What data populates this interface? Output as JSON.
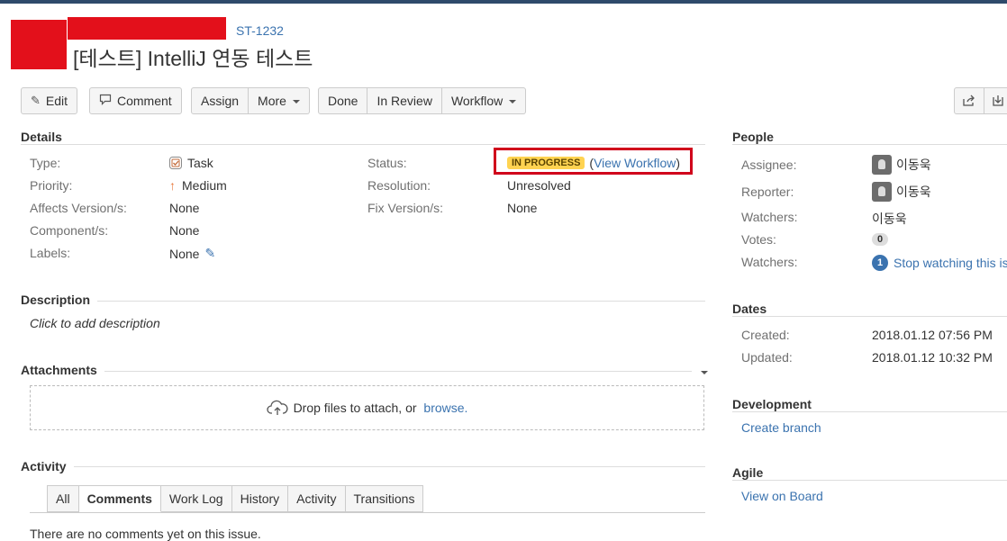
{
  "issue": {
    "key": "ST-1232",
    "title": "[테스트] IntelliJ 연동 테스트"
  },
  "toolbar": {
    "edit": "Edit",
    "comment": "Comment",
    "assign": "Assign",
    "more": "More",
    "done": "Done",
    "in_review": "In Review",
    "workflow": "Workflow"
  },
  "details": {
    "title": "Details",
    "type_label": "Type:",
    "type_value": "Task",
    "priority_label": "Priority:",
    "priority_value": "Medium",
    "affects_label": "Affects Version/s:",
    "affects_value": "None",
    "component_label": "Component/s:",
    "component_value": "None",
    "labels_label": "Labels:",
    "labels_value": "None",
    "status_label": "Status:",
    "status_value": "IN PROGRESS",
    "view_workflow": "View Workflow",
    "resolution_label": "Resolution:",
    "resolution_value": "Unresolved",
    "fix_label": "Fix Version/s:",
    "fix_value": "None"
  },
  "description": {
    "title": "Description",
    "placeholder": "Click to add description"
  },
  "attachments": {
    "title": "Attachments",
    "drop_text": "Drop files to attach, or ",
    "browse": "browse."
  },
  "activity": {
    "title": "Activity",
    "tabs": [
      "All",
      "Comments",
      "Work Log",
      "History",
      "Activity",
      "Transitions"
    ],
    "empty": "There are no comments yet on this issue."
  },
  "people": {
    "title": "People",
    "assignee_label": "Assignee:",
    "assignee_value": "이동욱",
    "reporter_label": "Reporter:",
    "reporter_value": "이동욱",
    "watchers_label": "Watchers:",
    "watchers_value": "이동욱",
    "votes_label": "Votes:",
    "votes_value": "0",
    "watchers2_label": "Watchers:",
    "watch_count": "1",
    "stop_watching": "Stop watching this issue"
  },
  "dates": {
    "title": "Dates",
    "created_label": "Created:",
    "created_value": "2018.01.12 07:56 PM",
    "updated_label": "Updated:",
    "updated_value": "2018.01.12 10:32 PM"
  },
  "development": {
    "title": "Development",
    "create_branch": "Create branch"
  },
  "agile": {
    "title": "Agile",
    "view_board": "View on Board"
  },
  "colors": {
    "link": "#3b73af",
    "lozenge": "#ffd351",
    "highlight": "#d0021b"
  }
}
